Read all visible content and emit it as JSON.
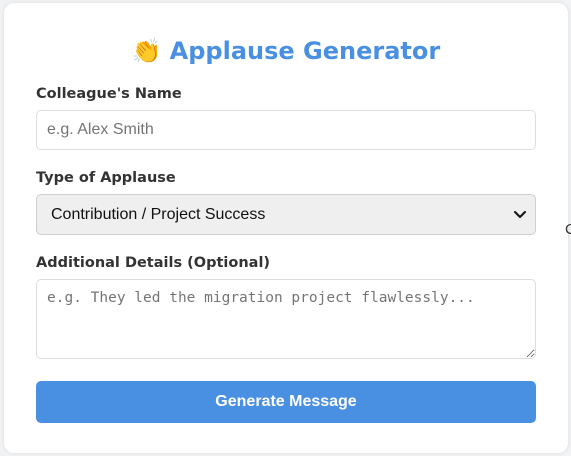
{
  "app": {
    "title": "Applause Generator",
    "title_emoji": "👏",
    "accent_color": "#4a90e2"
  },
  "form": {
    "name_label": "Colleague's Name",
    "name_placeholder": "e.g. Alex Smith",
    "name_value": "",
    "type_label": "Type of Applause",
    "type_selected": "Contribution / Project Success",
    "details_label": "Additional Details (Optional)",
    "details_placeholder": "e.g. They led the migration project flawlessly...",
    "details_value": "",
    "submit_label": "Generate Message"
  },
  "icons": {
    "title_icon": "clapping-hands-icon",
    "select_icon": "chevron-down-icon",
    "resize_icon": "resize-handle-icon"
  },
  "background": {
    "edge_fragment_text": "C"
  }
}
